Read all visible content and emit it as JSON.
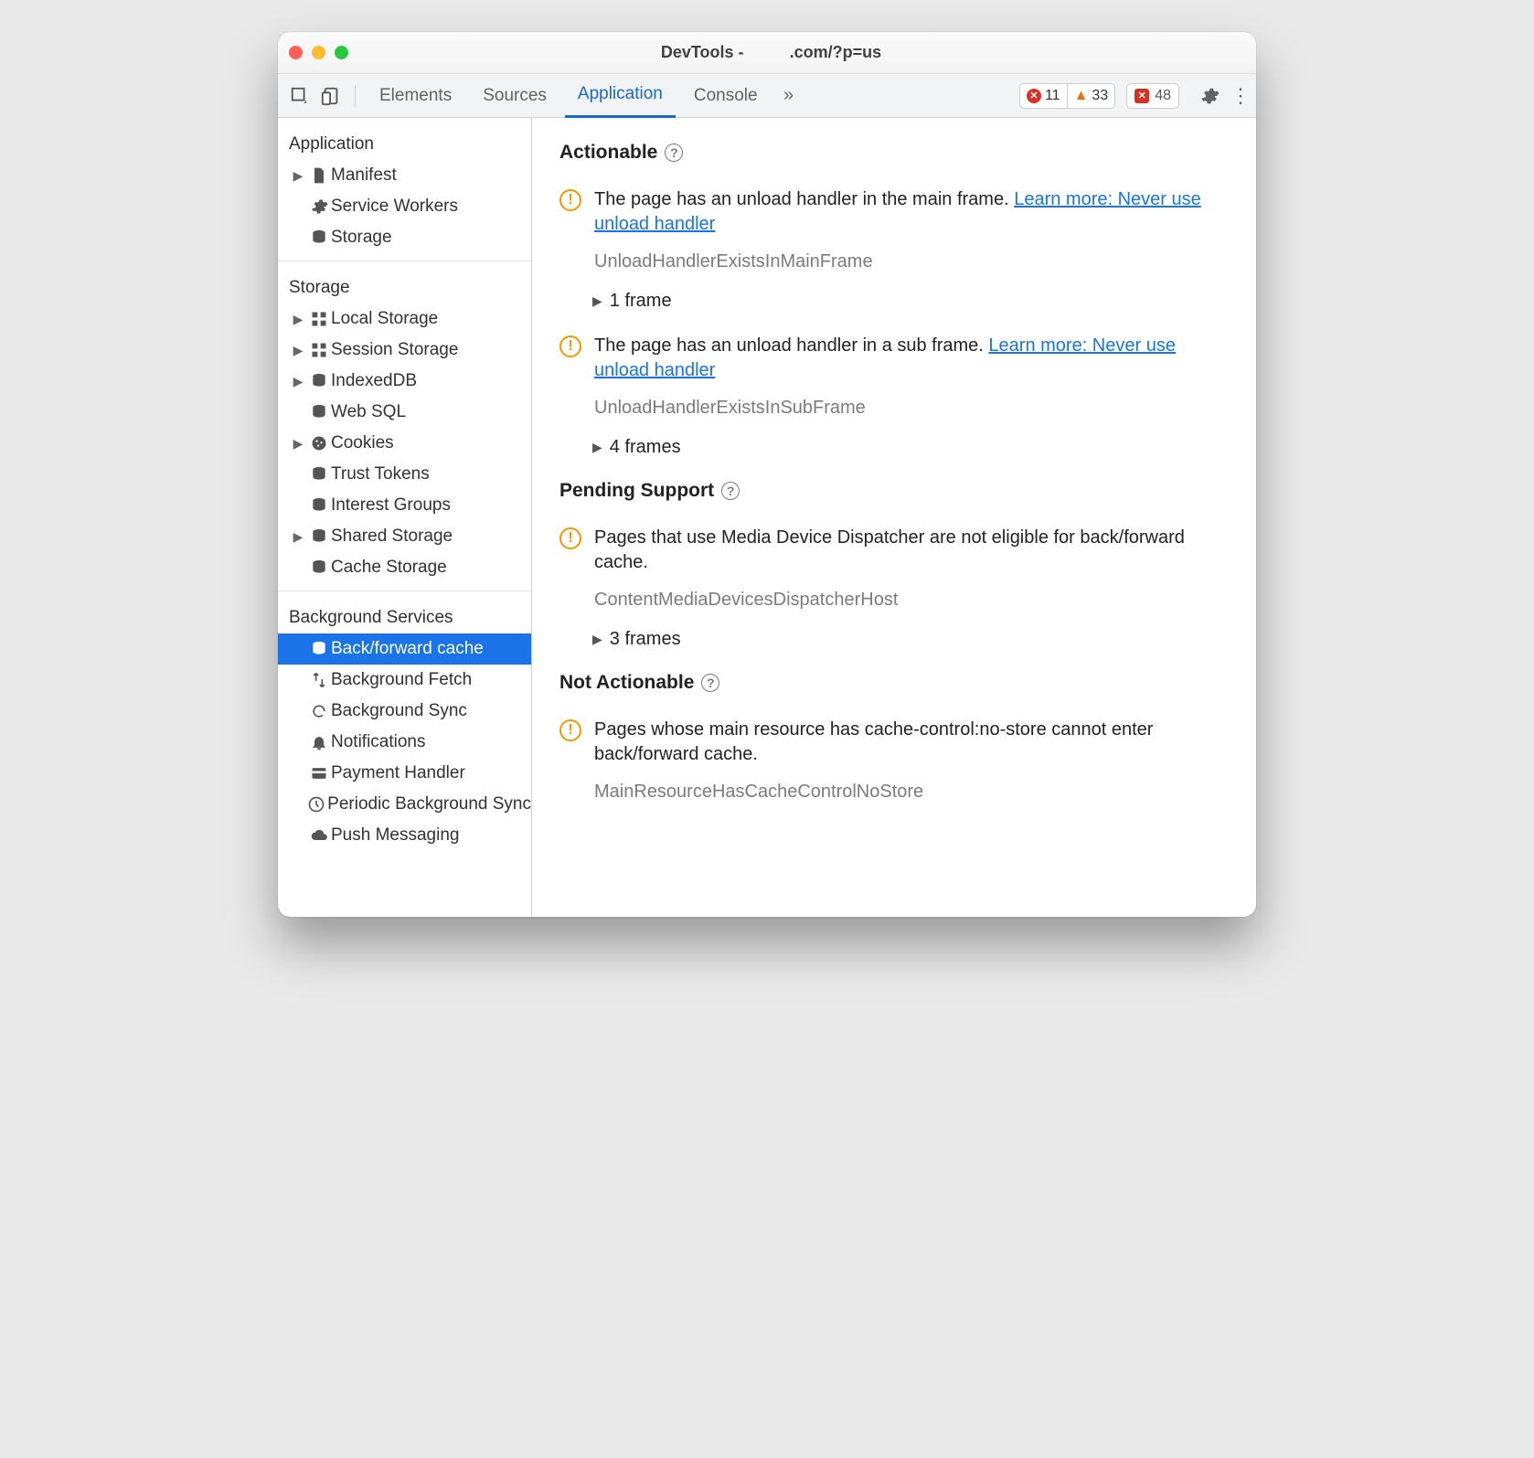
{
  "titlebar": {
    "prefix": "DevTools - ",
    "suffix": ".com/?p=us"
  },
  "toolbar": {
    "tabs": {
      "elements": "Elements",
      "sources": "Sources",
      "application": "Application",
      "console": "Console"
    },
    "errors_count": "11",
    "warnings_count": "33",
    "issues_count": "48"
  },
  "sidebar": {
    "sections": {
      "application": "Application",
      "storage": "Storage",
      "background": "Background Services"
    },
    "app": {
      "manifest": "Manifest",
      "service_workers": "Service Workers",
      "storage": "Storage"
    },
    "storage": {
      "local": "Local Storage",
      "session": "Session Storage",
      "indexeddb": "IndexedDB",
      "websql": "Web SQL",
      "cookies": "Cookies",
      "trust": "Trust Tokens",
      "interest": "Interest Groups",
      "shared": "Shared Storage",
      "cache": "Cache Storage"
    },
    "background": {
      "bfcache": "Back/forward cache",
      "bgfetch": "Background Fetch",
      "bgsync": "Background Sync",
      "notif": "Notifications",
      "payment": "Payment Handler",
      "periodic": "Periodic Background Sync",
      "push": "Push Messaging"
    }
  },
  "main": {
    "sections": {
      "actionable": "Actionable",
      "pending": "Pending Support",
      "not_actionable": "Not Actionable"
    },
    "issues": {
      "a1": {
        "text": "The page has an unload handler in the main frame.",
        "link": "Learn more: Never use unload handler",
        "code": "UnloadHandlerExistsInMainFrame",
        "frames": "1 frame"
      },
      "a2": {
        "text": "The page has an unload handler in a sub frame.",
        "link": "Learn more: Never use unload handler",
        "code": "UnloadHandlerExistsInSubFrame",
        "frames": "4 frames"
      },
      "p1": {
        "text": "Pages that use Media Device Dispatcher are not eligible for back/forward cache.",
        "code": "ContentMediaDevicesDispatcherHost",
        "frames": "3 frames"
      },
      "n1": {
        "text": "Pages whose main resource has cache-control:no-store cannot enter back/forward cache.",
        "code": "MainResourceHasCacheControlNoStore"
      }
    }
  }
}
